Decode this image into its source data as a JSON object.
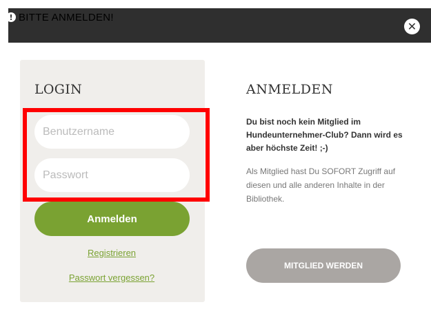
{
  "header": {
    "title": "BITTE ANMELDEN!",
    "alert_icon": "!",
    "close_icon": "✕"
  },
  "login": {
    "title": "LOGIN",
    "username_placeholder": "Benutzername",
    "password_placeholder": "Passwort",
    "username_value": "",
    "password_value": "",
    "submit_label": "Anmelden",
    "register_link": "Registrieren",
    "forgot_link": "Passwort vergessen?"
  },
  "signup": {
    "title": "ANMELDEN",
    "intro": "Du bist noch kein Mitglied im Hundeunternehmer-Club? Dann wird es aber höchste Zeit! ;-)",
    "info": "Als Mitglied hast Du SOFORT Zugriff auf diesen und alle anderen Inhalte in der Bibliothek.",
    "button_label": "MITGLIED WERDEN"
  },
  "colors": {
    "header_bg": "#2f2f2f",
    "accent_green": "#7aa232",
    "panel_bg": "#f0eeeb",
    "member_button_bg": "#aaa6a3",
    "highlight": "#ff0000"
  }
}
